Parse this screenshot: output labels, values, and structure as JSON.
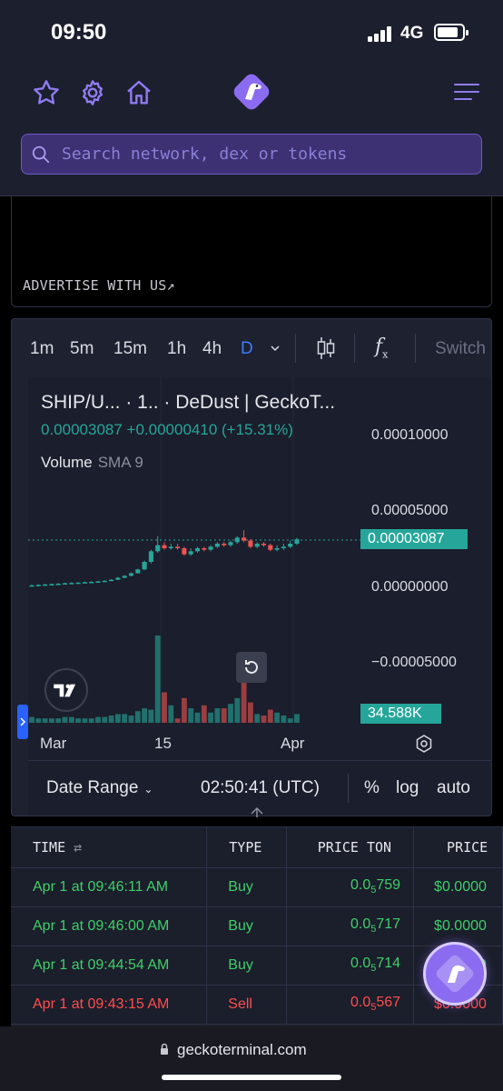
{
  "status": {
    "time": "09:50",
    "network": "4G"
  },
  "header": {
    "icons": [
      "star-icon",
      "gear-icon",
      "home-icon",
      "geckoterminal-logo",
      "menu-icon"
    ],
    "search_placeholder": "Search network, dex or tokens"
  },
  "ad": {
    "link": "ADVERTISE WITH US↗"
  },
  "toolbar": {
    "timeframes": [
      "1m",
      "5m",
      "15m",
      "1h",
      "4h",
      "D"
    ],
    "active": "D",
    "switch_label": "Switch",
    "fx_label": "f",
    "fx_sub": "x"
  },
  "chart": {
    "legend_title": "SHIP/U... · 1.. · DeDust | GeckoT...",
    "legend_values": "0.00003087 +0.00000410 (+15.31%)",
    "volume_label": "Volume",
    "sma_label": "SMA 9",
    "y_labels": [
      "0.00010000",
      "0.00005000",
      "0.00000000",
      "−0.00005000"
    ],
    "price_tag": "0.00003087",
    "volume_tag": "34.588K",
    "x_labels": [
      "Mar",
      "15",
      "Apr"
    ],
    "date_range": "Date Range",
    "utc_time": "02:50:41 (UTC)",
    "pct": "%",
    "log": "log",
    "auto": "auto",
    "up_color": "#26a69a",
    "down_color": "#ef5350"
  },
  "chart_data": {
    "type": "candlestick",
    "title": "SHIP/U... · 1.. · DeDust | GeckoT...",
    "x_labels": [
      "Mar",
      "15",
      "Apr"
    ],
    "ylim": [
      -5e-05,
      0.0001
    ],
    "last_price": 3.087e-05,
    "change": 4.1e-06,
    "change_pct": 15.31,
    "last_volume": "34.588K",
    "candles": [
      {
        "o": 3e-07,
        "c": 5e-07,
        "h": 1e-06,
        "l": 2e-07,
        "v": 0.04
      },
      {
        "o": 5e-07,
        "c": 8e-07,
        "h": 1.2e-06,
        "l": 4e-07,
        "v": 0.03
      },
      {
        "o": 8e-07,
        "c": 1.1e-06,
        "h": 1.5e-06,
        "l": 7e-07,
        "v": 0.03
      },
      {
        "o": 1.1e-06,
        "c": 1.3e-06,
        "h": 1.7e-06,
        "l": 1e-06,
        "v": 0.03
      },
      {
        "o": 1.3e-06,
        "c": 1.6e-06,
        "h": 2e-06,
        "l": 1.2e-06,
        "v": 0.03
      },
      {
        "o": 1.6e-06,
        "c": 1.9e-06,
        "h": 2.2e-06,
        "l": 1.5e-06,
        "v": 0.04
      },
      {
        "o": 1.9e-06,
        "c": 2.1e-06,
        "h": 2.5e-06,
        "l": 1.8e-06,
        "v": 0.04
      },
      {
        "o": 2.1e-06,
        "c": 2.3e-06,
        "h": 2.6e-06,
        "l": 2e-06,
        "v": 0.03
      },
      {
        "o": 2.3e-06,
        "c": 2.6e-06,
        "h": 3e-06,
        "l": 2.2e-06,
        "v": 0.03
      },
      {
        "o": 2.6e-06,
        "c": 2.8e-06,
        "h": 3.2e-06,
        "l": 2.5e-06,
        "v": 0.03
      },
      {
        "o": 2.8e-06,
        "c": 3.1e-06,
        "h": 3.5e-06,
        "l": 2.7e-06,
        "v": 0.04
      },
      {
        "o": 3.1e-06,
        "c": 3.5e-06,
        "h": 3.8e-06,
        "l": 3e-06,
        "v": 0.04
      },
      {
        "o": 3.5e-06,
        "c": 4.2e-06,
        "h": 4.6e-06,
        "l": 3.3e-06,
        "v": 0.05
      },
      {
        "o": 4.2e-06,
        "c": 5.5e-06,
        "h": 6e-06,
        "l": 4e-06,
        "v": 0.06
      },
      {
        "o": 5.5e-06,
        "c": 6.8e-06,
        "h": 7.2e-06,
        "l": 5.2e-06,
        "v": 0.06
      },
      {
        "o": 6.8e-06,
        "c": 8.5e-06,
        "h": 9e-06,
        "l": 6.5e-06,
        "v": 0.05
      },
      {
        "o": 8.5e-06,
        "c": 1.1e-05,
        "h": 1.15e-05,
        "l": 8.2e-06,
        "v": 0.08
      },
      {
        "o": 1.1e-05,
        "c": 1.6e-05,
        "h": 1.68e-05,
        "l": 1.06e-05,
        "v": 0.1
      },
      {
        "o": 1.6e-05,
        "c": 2.3e-05,
        "h": 2.4e-05,
        "l": 1.5e-05,
        "v": 0.09
      },
      {
        "o": 2.3e-05,
        "c": 2.7e-05,
        "h": 3.3e-05,
        "l": 2.2e-05,
        "v": 0.6
      },
      {
        "o": 2.7e-05,
        "c": 2.5e-05,
        "h": 2.9e-05,
        "l": 2.4e-05,
        "v": 0.21
      },
      {
        "o": 2.5e-05,
        "c": 2.6e-05,
        "h": 2.8e-05,
        "l": 2.4e-05,
        "v": 0.12
      },
      {
        "o": 2.6e-05,
        "c": 2.5e-05,
        "h": 2.8e-05,
        "l": 2.4e-05,
        "v": 0.03
      },
      {
        "o": 2.5e-05,
        "c": 2.1e-05,
        "h": 2.6e-05,
        "l": 2e-05,
        "v": 0.17
      },
      {
        "o": 2.1e-05,
        "c": 2.3e-05,
        "h": 2.5e-05,
        "l": 2e-05,
        "v": 0.1
      },
      {
        "o": 2.3e-05,
        "c": 2.5e-05,
        "h": 2.6e-05,
        "l": 2.2e-05,
        "v": 0.07
      },
      {
        "o": 2.5e-05,
        "c": 2.4e-05,
        "h": 2.6e-05,
        "l": 2.3e-05,
        "v": 0.12
      },
      {
        "o": 2.4e-05,
        "c": 2.6e-05,
        "h": 2.7e-05,
        "l": 2.3e-05,
        "v": 0.07
      },
      {
        "o": 2.6e-05,
        "c": 2.8e-05,
        "h": 2.9e-05,
        "l": 2.5e-05,
        "v": 0.1
      },
      {
        "o": 2.8e-05,
        "c": 2.7e-05,
        "h": 2.9e-05,
        "l": 2.6e-05,
        "v": 0.1
      },
      {
        "o": 2.7e-05,
        "c": 2.9e-05,
        "h": 3e-05,
        "l": 2.6e-05,
        "v": 0.13
      },
      {
        "o": 2.9e-05,
        "c": 3.2e-05,
        "h": 3.3e-05,
        "l": 2.8e-05,
        "v": 0.17
      },
      {
        "o": 3.2e-05,
        "c": 3e-05,
        "h": 3.7e-05,
        "l": 2.9e-05,
        "v": 0.35
      },
      {
        "o": 3e-05,
        "c": 2.6e-05,
        "h": 3.1e-05,
        "l": 2.5e-05,
        "v": 0.14
      },
      {
        "o": 2.6e-05,
        "c": 2.8e-05,
        "h": 2.9e-05,
        "l": 2.5e-05,
        "v": 0.06
      },
      {
        "o": 2.8e-05,
        "c": 2.7e-05,
        "h": 2.9e-05,
        "l": 2.6e-05,
        "v": 0.05
      },
      {
        "o": 2.7e-05,
        "c": 2.4e-05,
        "h": 2.8e-05,
        "l": 2.3e-05,
        "v": 0.09
      },
      {
        "o": 2.4e-05,
        "c": 2.5e-05,
        "h": 2.7e-05,
        "l": 2.3e-05,
        "v": 0.07
      },
      {
        "o": 2.5e-05,
        "c": 2.6e-05,
        "h": 2.8e-05,
        "l": 2.4e-05,
        "v": 0.05
      },
      {
        "o": 2.6e-05,
        "c": 2.8e-05,
        "h": 3e-05,
        "l": 2.5e-05,
        "v": 0.03
      },
      {
        "o": 2.8e-05,
        "c": 3.09e-05,
        "h": 3.2e-05,
        "l": 2.7e-05,
        "v": 0.06
      }
    ]
  },
  "trades": {
    "headers": [
      "TIME",
      "TYPE",
      "PRICE TON",
      "PRICE"
    ],
    "rows": [
      {
        "time": "Apr 1 at 09:46:11 AM",
        "type": "Buy",
        "pton_main": "0.0",
        "pton_sub": "5",
        "pton_tail": "759",
        "pusd": "$0.0000",
        "side": "buy"
      },
      {
        "time": "Apr 1 at 09:46:00 AM",
        "type": "Buy",
        "pton_main": "0.0",
        "pton_sub": "5",
        "pton_tail": "717",
        "pusd": "$0.0000",
        "side": "buy"
      },
      {
        "time": "Apr 1 at 09:44:54 AM",
        "type": "Buy",
        "pton_main": "0.0",
        "pton_sub": "5",
        "pton_tail": "714",
        "pusd": "$0.0000",
        "side": "buy"
      },
      {
        "time": "Apr 1 at 09:43:15 AM",
        "type": "Sell",
        "pton_main": "0.0",
        "pton_sub": "5",
        "pton_tail": "567",
        "pusd": "$0.0000",
        "side": "sell"
      }
    ]
  },
  "browser": {
    "url": "geckoterminal.com"
  }
}
